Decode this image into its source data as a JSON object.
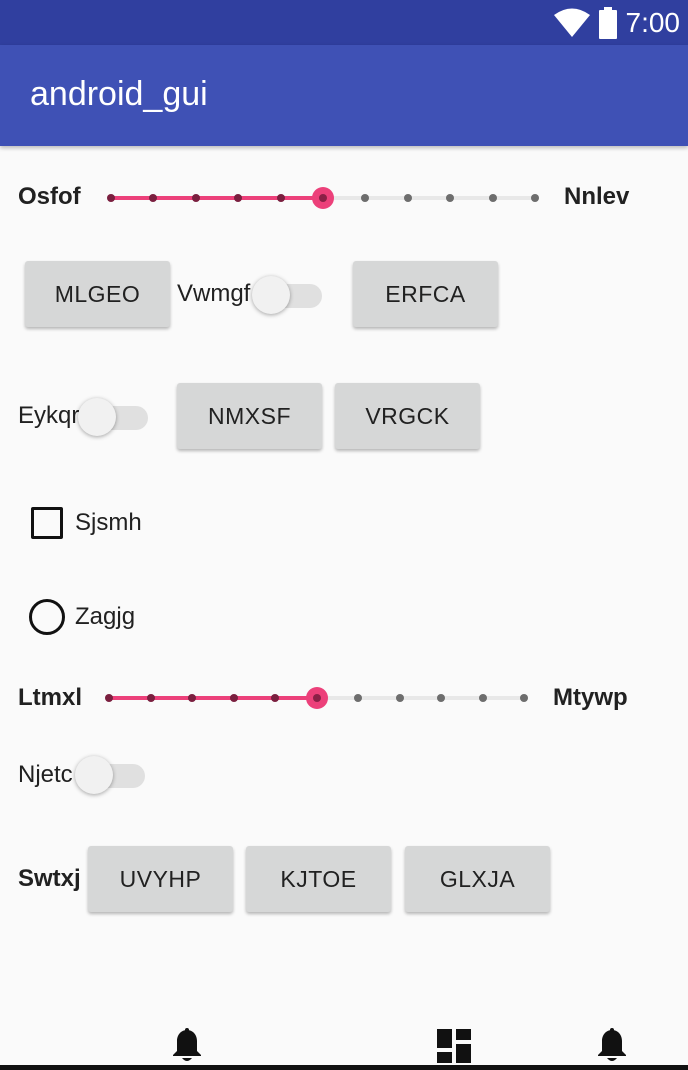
{
  "status_bar": {
    "time": "7:00",
    "icons": [
      "wifi-icon",
      "battery-icon"
    ]
  },
  "app_bar": {
    "title": "android_gui"
  },
  "slider1": {
    "left_label": "Osfof",
    "right_label": "Nnlev",
    "value": 5,
    "max": 10
  },
  "row1": {
    "button1": "MLGEO",
    "switch_label": "Vwmgf",
    "switch_on": false,
    "button2": "ERFCA"
  },
  "row2": {
    "switch_label": "Eykqr",
    "switch_on": false,
    "button1": "NMXSF",
    "button2": "VRGCK"
  },
  "checkbox": {
    "label": "Sjsmh",
    "checked": false
  },
  "radio": {
    "label": "Zagjg",
    "checked": false
  },
  "slider2": {
    "left_label": "Ltmxl",
    "right_label": "Mtywp",
    "value": 5,
    "max": 10
  },
  "row3": {
    "switch_label": "Njetc",
    "switch_on": false
  },
  "row4": {
    "label": "Swtxj",
    "button1": "UVYHP",
    "button2": "KJTOE",
    "button3": "GLXJA"
  },
  "bottom_nav": {
    "icons": [
      "bell-icon",
      "dashboard-icon",
      "bell-icon"
    ]
  },
  "colors": {
    "status_bar": "#303f9f",
    "app_bar": "#3f51b5",
    "accent": "#ec407a",
    "background": "#fafafa"
  }
}
